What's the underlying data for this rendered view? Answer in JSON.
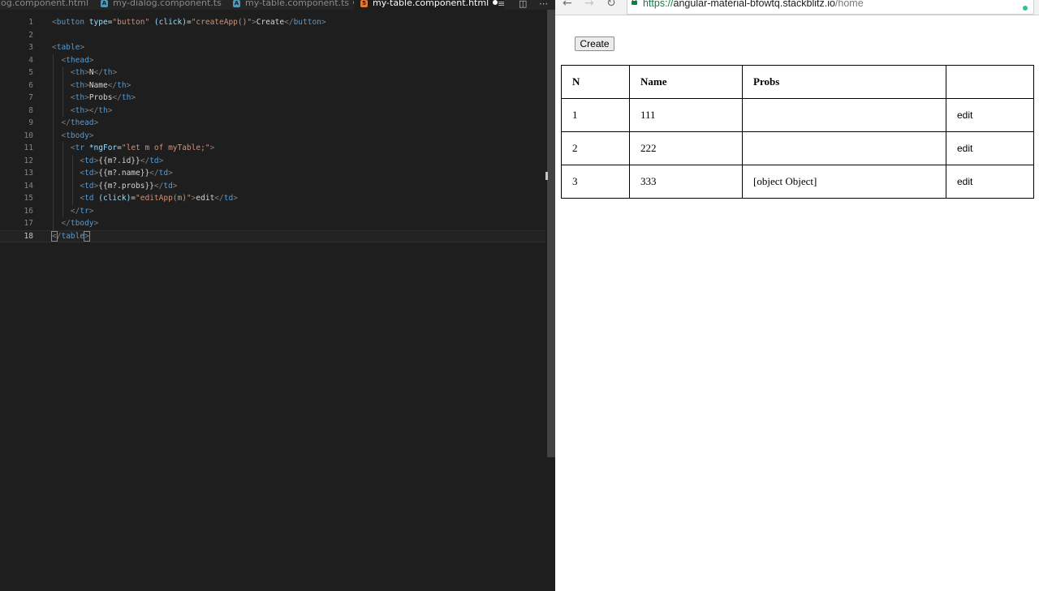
{
  "editor": {
    "tabs": [
      {
        "label": "log.component.html",
        "icon": "html-file-icon",
        "modified": false,
        "active": false
      },
      {
        "label": "my-dialog.component.ts",
        "icon": "typescript-file-icon",
        "modified": false,
        "active": false
      },
      {
        "label": "my-table.component.ts",
        "icon": "typescript-file-icon",
        "modified": true,
        "active": false
      },
      {
        "label": "my-table.component.html",
        "icon": "html-file-icon",
        "modified": true,
        "active": true
      }
    ],
    "toolbar_icons": [
      "outline-icon",
      "split-editor-icon",
      "more-actions-icon"
    ],
    "current_line": 18,
    "lines": [
      "<button type=\"button\" (click)=\"createApp()\">Create</button>",
      "",
      "<table>",
      "  <thead>",
      "    <th>N</th>",
      "    <th>Name</th>",
      "    <th>Probs</th>",
      "    <th></th>",
      "  </thead>",
      "  <tbody>",
      "    <tr *ngFor=\"let m of myTable;\">",
      "      <td>{{m?.id}}</td>",
      "      <td>{{m?.name}}</td>",
      "      <td>{{m?.probs}}</td>",
      "      <td (click)=\"editApp(m)\">edit</td>",
      "    </tr>",
      "  </tbody>",
      "</table>"
    ]
  },
  "browser": {
    "url": {
      "protocol": "https://",
      "host": "angular-material-bfowtq.stackblitz.io",
      "path": "/home"
    },
    "nav_icons": [
      "back-arrow-icon",
      "forward-arrow-icon",
      "reload-icon",
      "lock-icon"
    ],
    "page": {
      "create_button": "Create",
      "table": {
        "headers": [
          "N",
          "Name",
          "Probs",
          ""
        ],
        "rows": [
          {
            "id": "1",
            "name": "111",
            "probs": "",
            "action": "edit"
          },
          {
            "id": "2",
            "name": "222",
            "probs": "",
            "action": "edit"
          },
          {
            "id": "3",
            "name": "333",
            "probs": "[object Object]",
            "action": "edit"
          }
        ]
      }
    }
  },
  "colors": {
    "editor_bg": "#1e1e1e",
    "tag": "#569cd6",
    "attribute": "#9cdcfe",
    "string": "#ce9178",
    "text": "#d4d4d4",
    "secure_url": "#0b8043"
  }
}
